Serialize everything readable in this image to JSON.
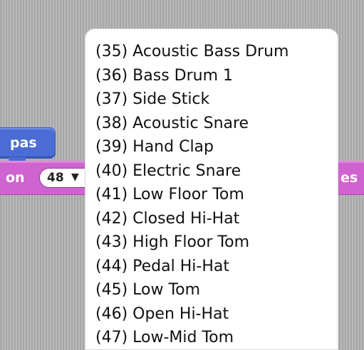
{
  "blocks": {
    "move": {
      "label": "pas"
    },
    "play_drum": {
      "left_text": "on",
      "drum_value": "48",
      "dropdown_arrow": "▼",
      "right_text": "es"
    }
  },
  "drum_menu": {
    "items": [
      {
        "label": "(35) Acoustic Bass Drum"
      },
      {
        "label": "(36) Bass Drum 1"
      },
      {
        "label": "(37) Side Stick"
      },
      {
        "label": "(38) Acoustic Snare"
      },
      {
        "label": "(39) Hand Clap"
      },
      {
        "label": "(40) Electric Snare"
      },
      {
        "label": "(41) Low Floor Tom"
      },
      {
        "label": "(42) Closed Hi-Hat"
      },
      {
        "label": "(43) High Floor Tom"
      },
      {
        "label": "(44) Pedal Hi-Hat"
      },
      {
        "label": "(45) Low Tom"
      },
      {
        "label": "(46) Open Hi-Hat"
      },
      {
        "label": "(47) Low-Mid Tom"
      }
    ]
  },
  "colors": {
    "motion_block": "#4a6cd4",
    "sound_block": "#cf63cf",
    "menu_background": "#ffffff",
    "script_area": "#b0b0b0"
  }
}
